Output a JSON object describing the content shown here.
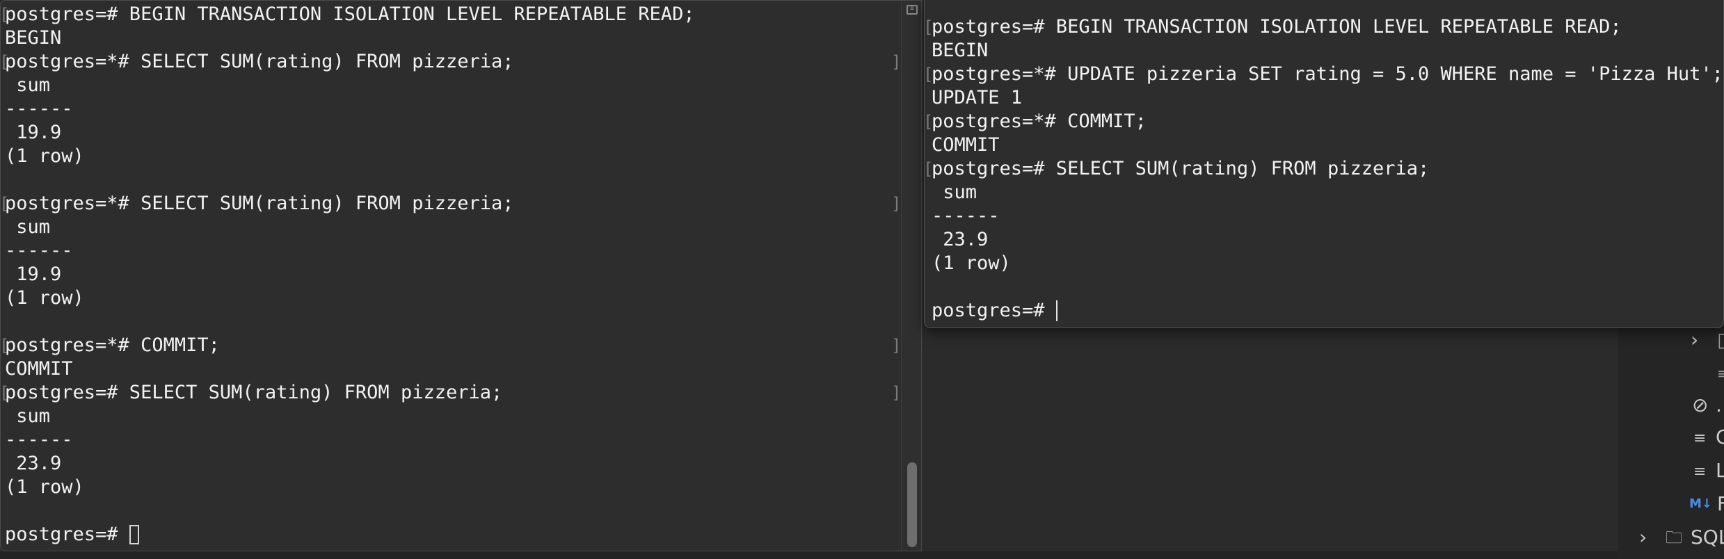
{
  "left_terminal": {
    "lines": [
      {
        "text": "postgres=# BEGIN TRANSACTION ISOLATION LEVEL REPEATABLE READ;",
        "marked": true
      },
      {
        "text": "BEGIN",
        "marked": false
      },
      {
        "text": "postgres=*# SELECT SUM(rating) FROM pizzeria;",
        "marked": true
      },
      {
        "text": " sum",
        "marked": false
      },
      {
        "text": "------",
        "marked": false
      },
      {
        "text": " 19.9",
        "marked": false
      },
      {
        "text": "(1 row)",
        "marked": false
      },
      {
        "text": "",
        "marked": false
      },
      {
        "text": "postgres=*# SELECT SUM(rating) FROM pizzeria;",
        "marked": true
      },
      {
        "text": " sum",
        "marked": false
      },
      {
        "text": "------",
        "marked": false
      },
      {
        "text": " 19.9",
        "marked": false
      },
      {
        "text": "(1 row)",
        "marked": false
      },
      {
        "text": "",
        "marked": false
      },
      {
        "text": "postgres=*# COMMIT;",
        "marked": true
      },
      {
        "text": "COMMIT",
        "marked": false
      },
      {
        "text": "postgres=# SELECT SUM(rating) FROM pizzeria;",
        "marked": true
      },
      {
        "text": " sum",
        "marked": false
      },
      {
        "text": "------",
        "marked": false
      },
      {
        "text": " 23.9",
        "marked": false
      },
      {
        "text": "(1 row)",
        "marked": false
      },
      {
        "text": "",
        "marked": false
      }
    ],
    "prompt": "postgres=# ",
    "open_mark": "[",
    "close_mark": "]"
  },
  "right_terminal": {
    "lines": [
      {
        "text": "postgres=# BEGIN TRANSACTION ISOLATION LEVEL REPEATABLE READ;",
        "marked": true
      },
      {
        "text": "BEGIN",
        "marked": false
      },
      {
        "text": "postgres=*# UPDATE pizzeria SET rating = 5.0 WHERE name = 'Pizza Hut';",
        "marked": true
      },
      {
        "text": "UPDATE 1",
        "marked": false
      },
      {
        "text": "postgres=*# COMMIT;",
        "marked": true
      },
      {
        "text": "COMMIT",
        "marked": false
      },
      {
        "text": "postgres=# SELECT SUM(rating) FROM pizzeria;",
        "marked": true
      },
      {
        "text": " sum",
        "marked": false
      },
      {
        "text": "------",
        "marked": false
      },
      {
        "text": " 23.9",
        "marked": false
      },
      {
        "text": "(1 row)",
        "marked": false
      },
      {
        "text": "",
        "marked": false
      }
    ],
    "prompt": "postgres=# ",
    "open_mark": "["
  },
  "sidebar": {
    "chevron": "›",
    "item_1": "C",
    "item_2": "L",
    "md_badge": "M↓",
    "item_3": "F",
    "folder_chevron": "›",
    "folder_label": "SQL"
  },
  "colors": {
    "terminal_bg": "#2d2d2d",
    "terminal_text": "#f2f2f2",
    "md_badge": "#4a8fe7"
  }
}
